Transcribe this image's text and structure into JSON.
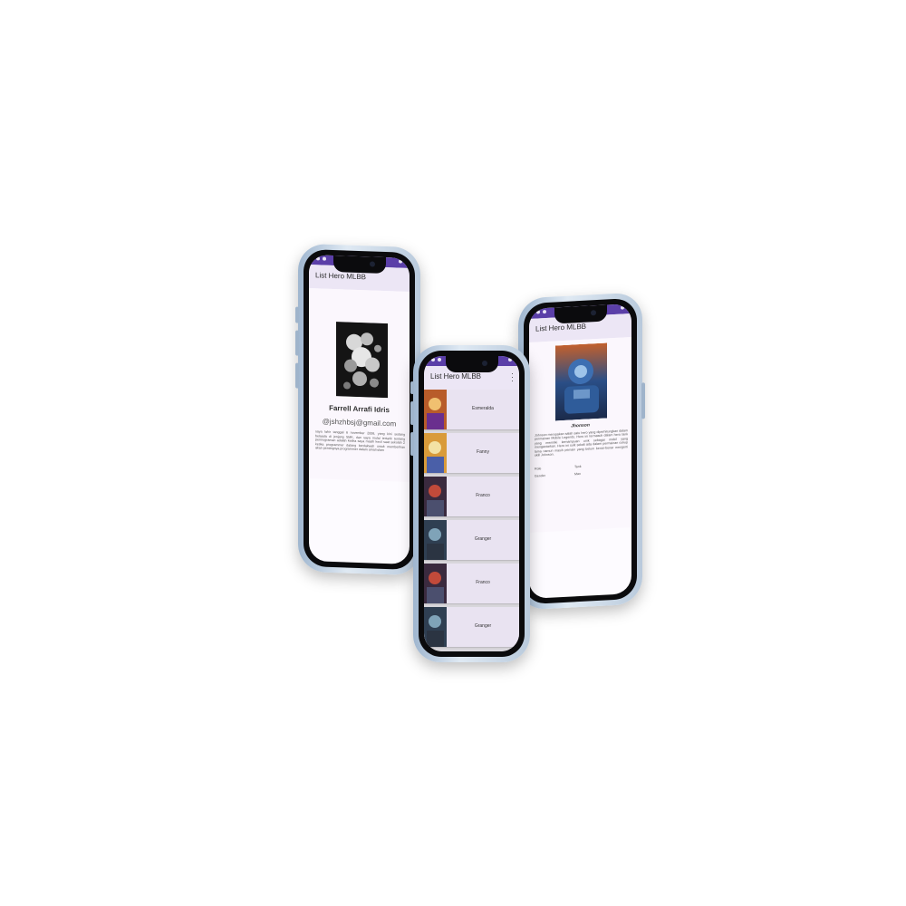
{
  "app": {
    "title": "List Hero MLBB"
  },
  "colors": {
    "status_bar": "#5b3fa8",
    "app_bar": "#ece6f5",
    "list_row": "#e9e3f1"
  },
  "profile": {
    "name": "Farrell Arrafi Idris",
    "email": "@jshzhbsj@gmail.com",
    "bio": "saya lahir tanggal 6 november 2006, yang kini sedang belaada di jenjang SMK, dan saya mulai tertarik tentang pemrograman adalah ketika saya masih kecil saat sekolah 2 ketika programmer datang berdakwah untuk memberikan akan pentingnya programmer dalam amal islam"
  },
  "hero_list": {
    "menu_icon": "overflow-menu-icon",
    "items": [
      {
        "label": "Esmeralda"
      },
      {
        "label": "Fanny"
      },
      {
        "label": "Franco"
      },
      {
        "label": "Granger"
      },
      {
        "label": "Franco"
      },
      {
        "label": "Granger"
      }
    ]
  },
  "hero_detail": {
    "name": "Jhonson",
    "description": "Johnson merupakan salah satu hero yang diperhitungkan dalam permainan Mobile Legends. Hero ini termasuk dalam hero tank yang memiliki kemampuan unik sebagai mobil yang mengantarkan. Hero ini sulit sekali ada dalam permainan cukup lama namun masih pemain yang belum benar-benar mengerti skill Johnson.",
    "role_label": "Role",
    "role_value": "Tank",
    "gender_label": "Gender",
    "gender_value": "Man"
  }
}
